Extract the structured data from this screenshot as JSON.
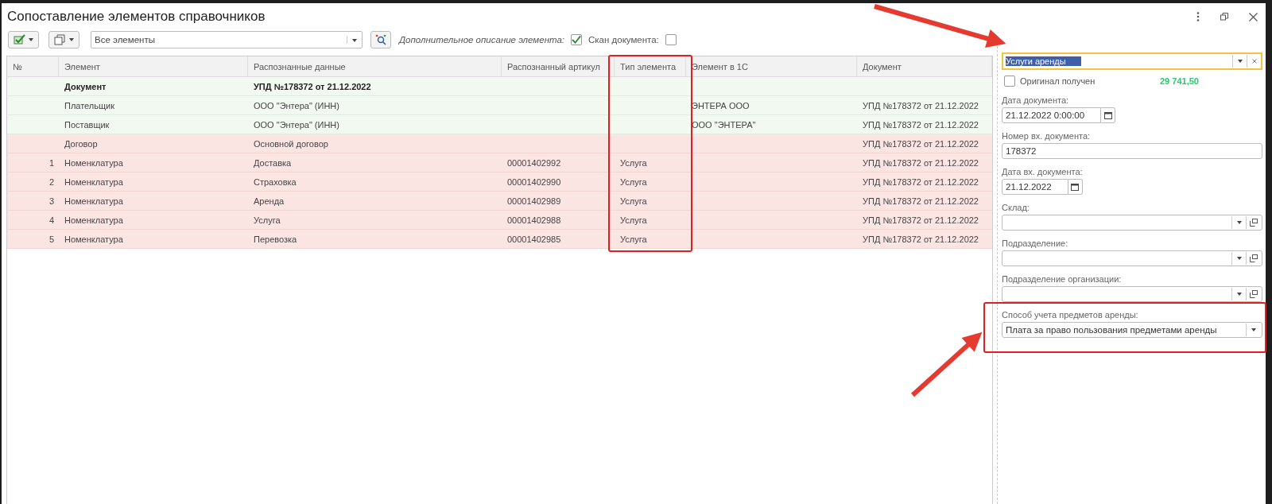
{
  "window": {
    "title": "Сопоставление элементов справочников"
  },
  "toolbar": {
    "filter": {
      "value": "Все элементы"
    },
    "options": [
      {
        "label": "Дополнительное описание элемента:",
        "checked": true,
        "kind": "italic"
      },
      {
        "label": "Скан документа:",
        "checked": false,
        "kind": "plain"
      }
    ]
  },
  "table": {
    "columns": [
      "№",
      "Элемент",
      "Распознанные данные",
      "Распознанный артикул",
      "Тип элемента",
      "Элемент в 1С",
      "Документ"
    ],
    "rows": [
      {
        "kind": "header",
        "matched": true,
        "cells": [
          "",
          "Документ",
          "УПД №178372 от 21.12.2022",
          "",
          "",
          "",
          ""
        ]
      },
      {
        "kind": "item",
        "matched": true,
        "cells": [
          "",
          "Плательщик",
          "ООО \"Энтера\" (ИНН)",
          "",
          "",
          "ЭНТЕРА ООО",
          "УПД №178372 от 21.12.2022"
        ]
      },
      {
        "kind": "item",
        "matched": true,
        "cells": [
          "",
          "Поставщик",
          "ООО \"Энтера\" (ИНН)",
          "",
          "",
          "ООО \"ЭНТЕРА\"",
          "УПД №178372 от 21.12.2022"
        ]
      },
      {
        "kind": "item",
        "matched": false,
        "cells": [
          "",
          "Договор",
          "Основной договор",
          "",
          "",
          "",
          "УПД №178372 от 21.12.2022"
        ]
      },
      {
        "kind": "item",
        "matched": false,
        "cells": [
          "1",
          "Номенклатура",
          "Доставка",
          "00001402992",
          "Услуга",
          "",
          "УПД №178372 от 21.12.2022"
        ]
      },
      {
        "kind": "item",
        "matched": false,
        "cells": [
          "2",
          "Номенклатура",
          "Страховка",
          "00001402990",
          "Услуга",
          "",
          "УПД №178372 от 21.12.2022"
        ]
      },
      {
        "kind": "item",
        "matched": false,
        "cells": [
          "3",
          "Номенклатура",
          "Аренда",
          "00001402989",
          "Услуга",
          "",
          "УПД №178372 от 21.12.2022"
        ]
      },
      {
        "kind": "item",
        "matched": false,
        "cells": [
          "4",
          "Номенклатура",
          "Услуга",
          "00001402988",
          "Услуга",
          "",
          "УПД №178372 от 21.12.2022"
        ]
      },
      {
        "kind": "item",
        "matched": false,
        "cells": [
          "5",
          "Номенклатура",
          "Перевозка",
          "00001402985",
          "Услуга",
          "",
          "УПД №178372 от 21.12.2022"
        ]
      }
    ]
  },
  "panel": {
    "element": {
      "value": "Услуги аренды"
    },
    "original": {
      "label": "Оригинал получен",
      "checked": false
    },
    "amount": "29 741,50",
    "fields": [
      {
        "kind": "date",
        "label": "Дата документа:",
        "value": "21.12.2022  0:00:00"
      },
      {
        "kind": "text",
        "label": "Номер вх. документа:",
        "value": "178372"
      },
      {
        "kind": "date",
        "label": "Дата вх. документа:",
        "value": "21.12.2022"
      },
      {
        "kind": "combo",
        "label": "Склад:"
      },
      {
        "kind": "combo",
        "label": "Подразделение:"
      },
      {
        "kind": "combo",
        "label": "Подразделение организации:"
      },
      {
        "kind": "select",
        "label": "Способ учета предметов аренды:",
        "value": "Плата за право пользования предметами аренды"
      }
    ]
  }
}
